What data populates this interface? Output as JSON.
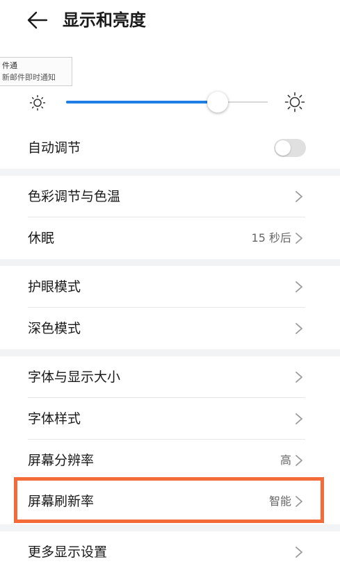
{
  "header": {
    "title": "显示和亮度"
  },
  "notification": {
    "title": "件通",
    "text": "新邮件即时通知"
  },
  "brightness": {
    "level": 0.75,
    "accent": "#1e7ee4"
  },
  "auto_adjust": {
    "label": "自动调节",
    "on": false
  },
  "rows": {
    "color": {
      "label": "色彩调节与色温"
    },
    "sleep": {
      "label": "休眠",
      "value": "15 秒后"
    },
    "eye": {
      "label": "护眼模式"
    },
    "dark": {
      "label": "深色模式"
    },
    "font_size": {
      "label": "字体与显示大小"
    },
    "font_style": {
      "label": "字体样式"
    },
    "resolution": {
      "label": "屏幕分辨率",
      "value": "高"
    },
    "refresh": {
      "label": "屏幕刷新率",
      "value": "智能"
    },
    "more": {
      "label": "更多显示设置"
    }
  },
  "highlight_color": "#f26b38"
}
